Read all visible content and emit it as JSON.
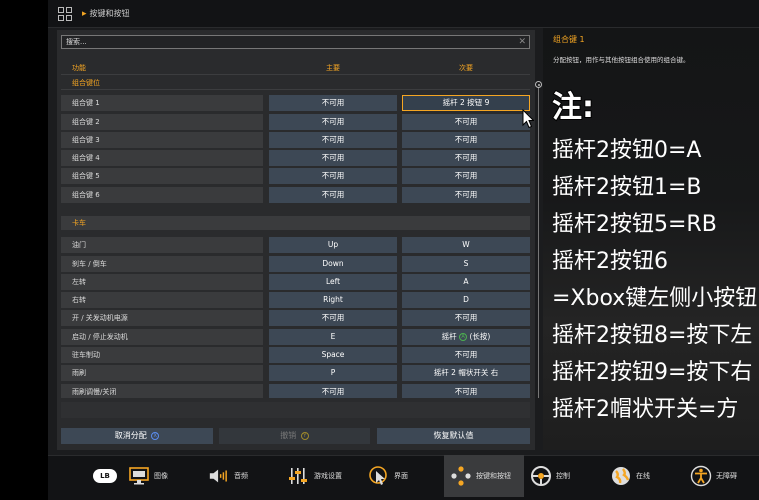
{
  "breadcrumb": {
    "separator": "▸",
    "label": "按键和按钮"
  },
  "search": {
    "placeholder": "搜索..."
  },
  "columns": {
    "function": "功能",
    "primary": "主要",
    "secondary": "次要"
  },
  "sections": [
    {
      "title": "组合键位"
    },
    {
      "title": "卡车"
    }
  ],
  "modifier_rows": [
    {
      "label": "组合键 1",
      "primary": "不可用",
      "secondary": "摇杆 2 按钮 9"
    },
    {
      "label": "组合键 2",
      "primary": "不可用",
      "secondary": "不可用"
    },
    {
      "label": "组合键 3",
      "primary": "不可用",
      "secondary": "不可用"
    },
    {
      "label": "组合键 4",
      "primary": "不可用",
      "secondary": "不可用"
    },
    {
      "label": "组合键 5",
      "primary": "不可用",
      "secondary": "不可用"
    },
    {
      "label": "组合键 6",
      "primary": "不可用",
      "secondary": "不可用"
    }
  ],
  "truck_rows": [
    {
      "label": "油门",
      "primary": "Up",
      "secondary": "W"
    },
    {
      "label": "刹车 / 倒车",
      "primary": "Down",
      "secondary": "S"
    },
    {
      "label": "左转",
      "primary": "Left",
      "secondary": "A"
    },
    {
      "label": "右转",
      "primary": "Right",
      "secondary": "D"
    },
    {
      "label": "开 / 关发动机电源",
      "primary": "不可用",
      "secondary": "不可用"
    },
    {
      "label": "启动 / 停止发动机",
      "primary": "E",
      "secondary_prefix": "摇杆",
      "secondary_suffix": "(长按)",
      "secondary_glyph": "A"
    },
    {
      "label": "驻车制动",
      "primary": "Space",
      "secondary": "不可用"
    },
    {
      "label": "雨刷",
      "primary": "P",
      "secondary": "摇杆 2 帽状开关 右"
    },
    {
      "label": "雨刷调慢/关闭",
      "primary": "不可用",
      "secondary": "不可用"
    }
  ],
  "actions": {
    "cancel": "取消分配",
    "cancel_glyph": "X",
    "undo": "撤销",
    "undo_glyph": "Y",
    "reset": "恢复默认值"
  },
  "detail": {
    "title": "组合键 1",
    "description": "分配按钮，用作与其他按钮组合使用的组合键。",
    "note_title": "注:",
    "note_lines": [
      "摇杆2按钮0=A",
      "摇杆2按钮1=B",
      "摇杆2按钮5=RB",
      "摇杆2按钮6",
      "=Xbox键左侧小按钮",
      "摇杆2按钮8=按下左",
      "摇杆2按钮9=按下右",
      "摇杆2帽状开关=方"
    ]
  },
  "bottom_nav": {
    "lb": "LB",
    "items": [
      {
        "label": "图像",
        "icon": "monitor-icon"
      },
      {
        "label": "音频",
        "icon": "speaker-icon"
      },
      {
        "label": "游戏设置",
        "icon": "sliders-icon"
      },
      {
        "label": "界面",
        "icon": "cursor-icon"
      },
      {
        "label": "按键和按钮",
        "icon": "gamepad-icon"
      },
      {
        "label": "控制",
        "icon": "steering-wheel-icon"
      },
      {
        "label": "在线",
        "icon": "globe-icon"
      },
      {
        "label": "无障碍",
        "icon": "accessibility-icon"
      }
    ]
  },
  "colors": {
    "accent": "#f5a623",
    "button": "#3d4855",
    "row": "#3a3b3d",
    "panel": "#2a2b2d"
  }
}
